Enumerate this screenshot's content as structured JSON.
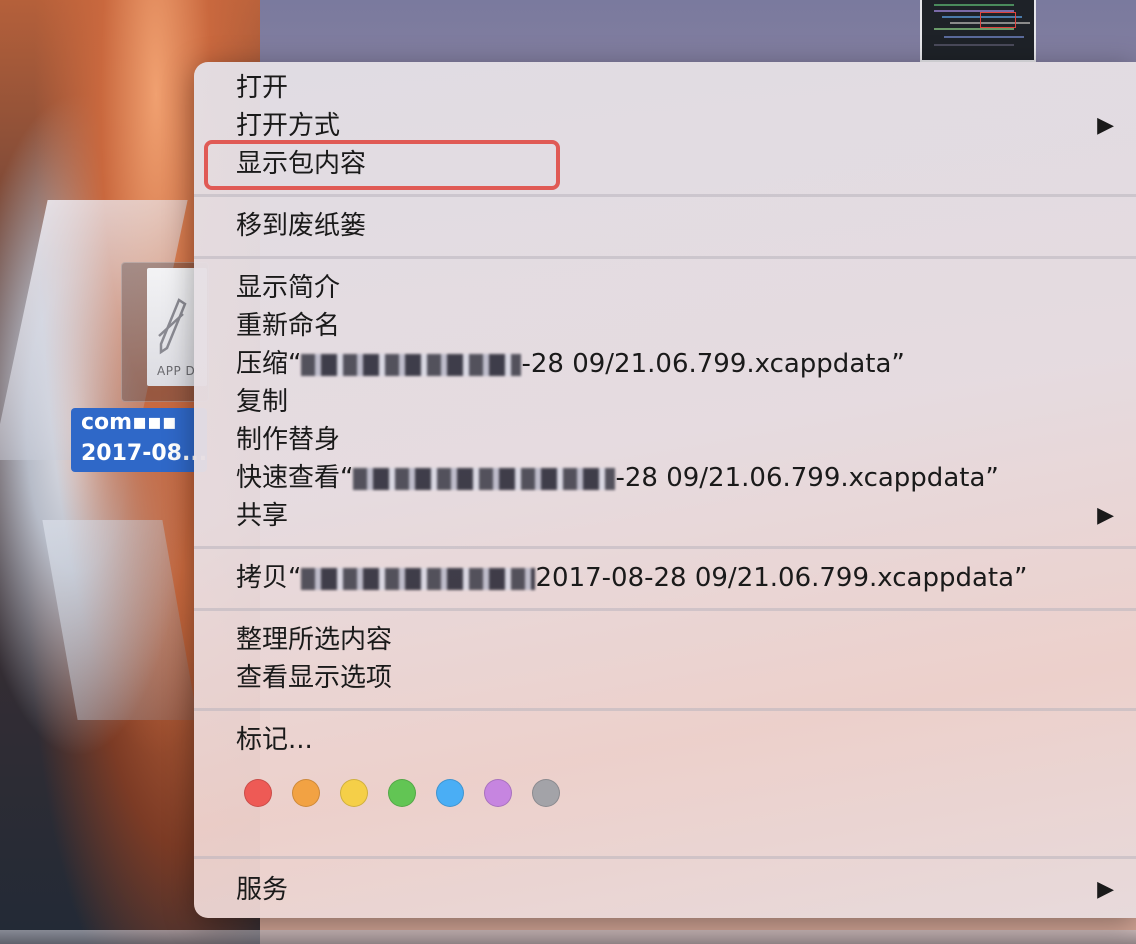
{
  "desktop": {
    "file_label_line1": "com▪▪▪",
    "file_label_line2": "2017-08...",
    "file_icon_text": "APP D"
  },
  "context_menu": {
    "items": {
      "open": "打开",
      "open_with": "打开方式",
      "show_package_contents": "显示包内容",
      "move_to_trash": "移到废纸篓",
      "get_info": "显示简介",
      "rename": "重新命名",
      "compress_prefix": "压缩“",
      "compress_suffix": "-28 09/21.06.799.xcappdata”",
      "duplicate": "复制",
      "make_alias": "制作替身",
      "quick_look_prefix": "快速查看“",
      "quick_look_suffix": "-28 09/21.06.799.xcappdata”",
      "share": "共享",
      "copy_prefix": "拷贝“",
      "copy_suffix": "2017-08-28 09/21.06.799.xcappdata”",
      "clean_up_selection": "整理所选内容",
      "show_view_options": "查看显示选项",
      "tags": "标记...",
      "services": "服务"
    },
    "submenu_arrow": "▶",
    "tag_colors": [
      "#ee5a55",
      "#f2a243",
      "#f5cf48",
      "#62c554",
      "#4aaef5",
      "#c685e0",
      "#a3a3a8"
    ]
  },
  "colors": {
    "highlight_border": "#e05a55",
    "selection_blue": "#2f68c8"
  }
}
